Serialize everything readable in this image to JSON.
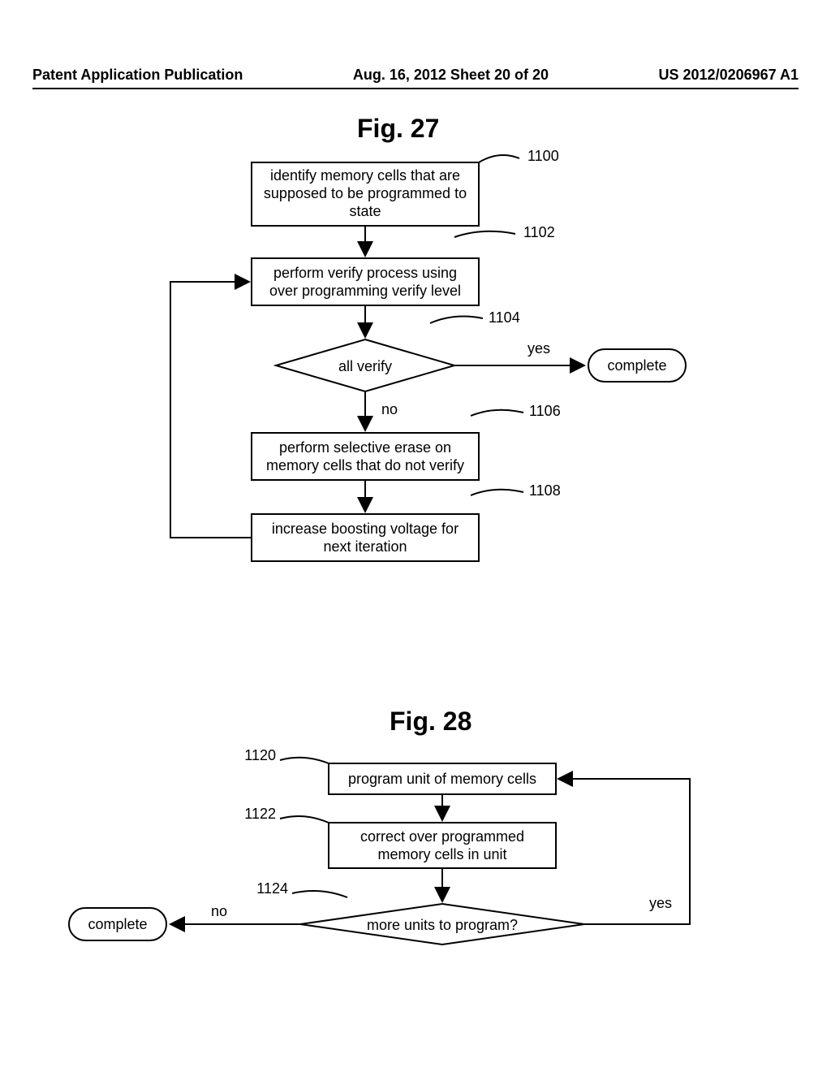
{
  "header": {
    "left": "Patent Application Publication",
    "center": "Aug. 16, 2012  Sheet 20 of 20",
    "right": "US 2012/0206967 A1"
  },
  "fig27": {
    "title": "Fig. 27",
    "steps": {
      "1100": {
        "ref": "1100",
        "line1": "identify memory cells that are",
        "line2": "supposed to be programmed to",
        "line3": "state"
      },
      "1102": {
        "ref": "1102",
        "line1": "perform verify process using",
        "line2": "over programming verify level"
      },
      "1104": {
        "ref": "1104",
        "text": "all verify"
      },
      "1106": {
        "ref": "1106",
        "line1": "perform selective erase on",
        "line2": "memory cells that do not verify"
      },
      "1108": {
        "ref": "1108",
        "line1": "increase boosting voltage for",
        "line2": "next iteration"
      }
    },
    "yes": "yes",
    "no": "no",
    "complete": "complete"
  },
  "fig28": {
    "title": "Fig. 28",
    "steps": {
      "1120": {
        "ref": "1120",
        "text": "program unit of memory cells"
      },
      "1122": {
        "ref": "1122",
        "line1": "correct over programmed",
        "line2": "memory cells in unit"
      },
      "1124": {
        "ref": "1124",
        "text": "more units to program?"
      }
    },
    "yes": "yes",
    "no": "no",
    "complete": "complete"
  }
}
